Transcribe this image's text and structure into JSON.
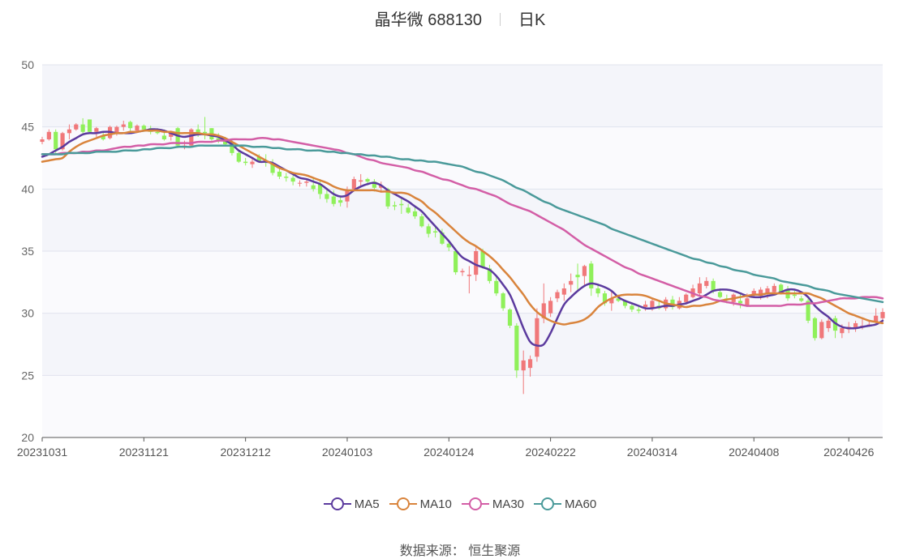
{
  "header": {
    "title": "晶华微 688130",
    "period": "日K"
  },
  "source": {
    "label": "数据来源：",
    "name": "恒生聚源"
  },
  "chart_data": {
    "type": "candlestick",
    "up_color": "#f0787a",
    "down_color": "#8ff05a",
    "ylim": [
      20,
      50
    ],
    "yticks": [
      20,
      25,
      30,
      35,
      40,
      45,
      50
    ],
    "grid": true,
    "xtick_labels": [
      "20231031",
      "20231121",
      "20231212",
      "20240103",
      "20240124",
      "20240222",
      "20240314",
      "20240408",
      "20240426"
    ],
    "xtick_index": [
      0,
      15,
      30,
      45,
      60,
      75,
      90,
      105,
      119
    ],
    "legend_position": "bottom",
    "ohlc": [
      [
        43.8,
        44.2,
        43.6,
        44.0
      ],
      [
        44.0,
        44.8,
        43.9,
        44.6
      ],
      [
        44.6,
        44.8,
        42.9,
        43.2
      ],
      [
        43.2,
        44.6,
        43.1,
        44.5
      ],
      [
        44.5,
        45.2,
        44.0,
        44.8
      ],
      [
        44.8,
        45.3,
        44.7,
        45.2
      ],
      [
        45.2,
        45.7,
        44.4,
        44.6
      ],
      [
        45.6,
        45.6,
        44.5,
        44.6
      ],
      [
        44.6,
        45.0,
        44.2,
        44.9
      ],
      [
        44.3,
        44.6,
        43.9,
        44.0
      ],
      [
        44.1,
        45.1,
        44.0,
        45.0
      ],
      [
        44.5,
        45.1,
        44.3,
        45.0
      ],
      [
        45.0,
        45.5,
        44.7,
        45.2
      ],
      [
        45.4,
        45.5,
        44.6,
        44.9
      ],
      [
        44.7,
        45.2,
        44.5,
        45.1
      ],
      [
        45.1,
        45.2,
        44.6,
        44.8
      ],
      [
        44.9,
        45.1,
        44.4,
        44.6
      ],
      [
        44.6,
        44.9,
        44.4,
        44.5
      ],
      [
        44.3,
        44.8,
        43.9,
        44.0
      ],
      [
        44.2,
        44.7,
        43.9,
        44.6
      ],
      [
        44.9,
        45.0,
        43.3,
        43.5
      ],
      [
        43.5,
        43.9,
        43.2,
        43.5
      ],
      [
        43.5,
        44.9,
        43.4,
        44.8
      ],
      [
        44.8,
        45.2,
        44.2,
        44.5
      ],
      [
        44.6,
        45.8,
        44.0,
        44.5
      ],
      [
        44.9,
        44.9,
        43.9,
        44.0
      ],
      [
        44.1,
        44.5,
        43.7,
        43.9
      ],
      [
        43.9,
        44.2,
        43.5,
        43.6
      ],
      [
        43.8,
        44.0,
        42.7,
        42.9
      ],
      [
        42.9,
        43.2,
        42.1,
        42.2
      ],
      [
        42.2,
        42.5,
        41.9,
        42.1
      ],
      [
        42.0,
        42.5,
        41.7,
        42.2
      ],
      [
        42.6,
        42.8,
        42.1,
        42.2
      ],
      [
        42.3,
        42.8,
        41.8,
        42.1
      ],
      [
        42.1,
        42.4,
        41.1,
        41.3
      ],
      [
        41.4,
        41.8,
        40.8,
        41.0
      ],
      [
        41.0,
        41.3,
        40.6,
        40.9
      ],
      [
        40.9,
        41.1,
        40.3,
        40.6
      ],
      [
        40.5,
        40.7,
        40.2,
        40.5
      ],
      [
        40.5,
        40.7,
        40.2,
        40.6
      ],
      [
        40.3,
        40.9,
        39.8,
        40.0
      ],
      [
        40.4,
        40.8,
        39.2,
        39.6
      ],
      [
        39.6,
        40.1,
        38.9,
        39.2
      ],
      [
        39.4,
        39.9,
        38.6,
        38.8
      ],
      [
        39.1,
        39.4,
        38.6,
        38.9
      ],
      [
        39.0,
        40.2,
        38.5,
        39.9
      ],
      [
        40.0,
        41.0,
        39.8,
        40.8
      ],
      [
        40.6,
        41.2,
        40.2,
        40.7
      ],
      [
        40.8,
        40.9,
        40.3,
        40.6
      ],
      [
        40.6,
        40.8,
        39.8,
        40.1
      ],
      [
        40.1,
        40.6,
        39.7,
        40.3
      ],
      [
        40.0,
        40.1,
        38.4,
        38.6
      ],
      [
        38.7,
        39.0,
        38.3,
        38.6
      ],
      [
        38.8,
        39.4,
        38.0,
        38.7
      ],
      [
        38.5,
        38.8,
        38.0,
        38.1
      ],
      [
        38.2,
        38.5,
        37.6,
        37.8
      ],
      [
        37.8,
        38.0,
        36.9,
        37.0
      ],
      [
        37.0,
        37.2,
        36.1,
        36.4
      ],
      [
        36.6,
        37.0,
        36.1,
        36.5
      ],
      [
        36.5,
        36.8,
        35.5,
        35.6
      ],
      [
        35.6,
        35.8,
        35.0,
        35.3
      ],
      [
        35.0,
        35.2,
        33.1,
        33.3
      ],
      [
        33.3,
        33.6,
        33.0,
        33.4
      ],
      [
        33.0,
        33.8,
        31.6,
        33.1
      ],
      [
        33.1,
        35.4,
        32.6,
        35.0
      ],
      [
        35.0,
        35.2,
        33.6,
        33.7
      ],
      [
        33.6,
        33.9,
        32.4,
        32.6
      ],
      [
        32.6,
        33.0,
        31.4,
        31.6
      ],
      [
        31.6,
        31.7,
        30.2,
        30.4
      ],
      [
        30.3,
        30.4,
        28.8,
        29.0
      ],
      [
        29.0,
        29.2,
        24.8,
        25.4
      ],
      [
        25.4,
        27.0,
        23.5,
        26.2
      ],
      [
        25.6,
        26.6,
        24.9,
        26.3
      ],
      [
        26.5,
        30.4,
        26.1,
        29.6
      ],
      [
        29.6,
        32.4,
        29.2,
        30.8
      ],
      [
        30.0,
        31.3,
        29.7,
        31.0
      ],
      [
        31.2,
        31.9,
        30.9,
        31.7
      ],
      [
        31.5,
        32.4,
        31.0,
        32.0
      ],
      [
        32.3,
        33.2,
        31.7,
        32.6
      ],
      [
        33.1,
        34.0,
        31.9,
        32.9
      ],
      [
        33.0,
        33.9,
        32.2,
        33.8
      ],
      [
        34.0,
        34.2,
        31.4,
        32.0
      ],
      [
        32.0,
        32.4,
        31.3,
        31.6
      ],
      [
        31.6,
        31.8,
        30.6,
        30.8
      ],
      [
        30.8,
        31.9,
        30.2,
        31.2
      ],
      [
        31.2,
        31.5,
        30.9,
        31.0
      ],
      [
        31.0,
        31.1,
        30.4,
        30.6
      ],
      [
        30.6,
        30.8,
        30.1,
        30.3
      ],
      [
        30.3,
        30.6,
        30.0,
        30.2
      ],
      [
        30.5,
        31.0,
        30.2,
        30.7
      ],
      [
        30.4,
        31.2,
        30.2,
        31.0
      ],
      [
        30.6,
        31.0,
        30.3,
        30.4
      ],
      [
        30.4,
        31.3,
        30.2,
        31.1
      ],
      [
        31.1,
        31.4,
        30.3,
        30.5
      ],
      [
        30.4,
        31.3,
        30.3,
        31.0
      ],
      [
        30.9,
        31.6,
        30.7,
        31.5
      ],
      [
        31.3,
        32.3,
        31.2,
        32.0
      ],
      [
        31.6,
        32.9,
        31.4,
        32.4
      ],
      [
        32.2,
        32.9,
        32.0,
        32.6
      ],
      [
        32.6,
        32.8,
        31.6,
        31.8
      ],
      [
        31.7,
        32.0,
        31.2,
        31.3
      ],
      [
        31.2,
        31.5,
        30.8,
        31.1
      ],
      [
        30.9,
        31.6,
        30.6,
        31.5
      ],
      [
        31.0,
        31.6,
        30.4,
        30.8
      ],
      [
        30.6,
        31.6,
        30.5,
        31.2
      ],
      [
        31.5,
        32.0,
        31.3,
        31.8
      ],
      [
        31.4,
        32.1,
        31.1,
        31.9
      ],
      [
        31.6,
        32.2,
        31.2,
        32.0
      ],
      [
        31.7,
        32.4,
        31.5,
        32.2
      ],
      [
        32.3,
        32.4,
        31.5,
        31.7
      ],
      [
        31.9,
        32.2,
        31.0,
        31.2
      ],
      [
        31.5,
        31.8,
        31.2,
        31.4
      ],
      [
        31.2,
        31.4,
        30.9,
        31.0
      ],
      [
        31.0,
        31.2,
        29.2,
        29.4
      ],
      [
        29.6,
        29.7,
        27.8,
        28.0
      ],
      [
        28.0,
        29.5,
        27.9,
        29.3
      ],
      [
        28.8,
        29.6,
        28.5,
        29.4
      ],
      [
        29.6,
        29.8,
        28.0,
        28.6
      ],
      [
        28.4,
        29.1,
        28.0,
        28.8
      ],
      [
        28.7,
        29.3,
        28.4,
        28.9
      ],
      [
        28.8,
        29.4,
        28.5,
        29.2
      ],
      [
        28.9,
        29.5,
        28.7,
        29.0
      ],
      [
        29.1,
        29.4,
        28.9,
        29.1
      ],
      [
        29.3,
        30.4,
        29.2,
        29.8
      ],
      [
        29.6,
        30.4,
        29.3,
        30.1
      ]
    ],
    "series": [
      {
        "name": "MA5",
        "color": "#5b3a9e",
        "values": [
          42.6,
          42.8,
          43.1,
          43.4,
          43.8,
          44.1,
          44.4,
          44.5,
          44.5,
          44.6,
          44.6,
          44.5,
          44.5,
          44.5,
          44.6,
          44.7,
          44.8,
          44.8,
          44.7,
          44.5,
          44.3,
          44.2,
          44.3,
          44.4,
          44.4,
          44.3,
          44.2,
          43.9,
          43.6,
          43.1,
          42.8,
          42.5,
          42.2,
          42.2,
          42.1,
          41.8,
          41.5,
          41.2,
          40.9,
          40.8,
          40.6,
          40.4,
          40.0,
          39.6,
          39.4,
          39.5,
          39.9,
          40.2,
          40.4,
          40.5,
          40.3,
          39.9,
          39.6,
          39.3,
          39.0,
          38.6,
          38.2,
          37.6,
          37.0,
          36.4,
          35.8,
          35.1,
          34.5,
          34.2,
          33.9,
          33.7,
          33.5,
          33.0,
          32.3,
          31.5,
          30.2,
          28.8,
          27.7,
          27.4,
          27.5,
          28.4,
          29.6,
          30.7,
          31.3,
          31.8,
          32.2,
          32.4,
          32.3,
          32.1,
          31.8,
          31.3,
          31.0,
          30.8,
          30.6,
          30.4,
          30.4,
          30.5,
          30.6,
          30.6,
          30.7,
          30.8,
          31.0,
          31.2,
          31.5,
          31.8,
          31.9,
          31.9,
          31.8,
          31.6,
          31.4,
          31.3,
          31.3,
          31.4,
          31.5,
          31.7,
          31.9,
          31.9,
          31.7,
          31.3,
          30.6,
          30.1,
          29.7,
          29.2,
          28.9,
          28.8,
          28.8,
          28.9,
          29.0,
          29.1,
          29.4
        ]
      },
      {
        "name": "MA10",
        "color": "#d9843c",
        "values": [
          42.2,
          42.3,
          42.4,
          42.5,
          43.0,
          43.4,
          43.7,
          43.9,
          44.1,
          44.3,
          44.4,
          44.5,
          44.5,
          44.6,
          44.6,
          44.7,
          44.7,
          44.7,
          44.6,
          44.6,
          44.5,
          44.5,
          44.5,
          44.5,
          44.4,
          44.4,
          44.3,
          44.1,
          43.8,
          43.5,
          43.2,
          42.9,
          42.6,
          42.3,
          42.0,
          41.7,
          41.5,
          41.3,
          41.2,
          41.1,
          40.9,
          40.7,
          40.5,
          40.2,
          40.0,
          39.9,
          39.9,
          39.9,
          39.9,
          39.9,
          39.8,
          39.8,
          39.7,
          39.7,
          39.6,
          39.3,
          39.0,
          38.5,
          38.1,
          37.6,
          37.1,
          36.6,
          36.1,
          35.7,
          35.4,
          35.0,
          34.6,
          34.1,
          33.5,
          32.9,
          32.2,
          31.5,
          30.7,
          30.1,
          29.7,
          29.4,
          29.2,
          29.1,
          29.2,
          29.3,
          29.5,
          29.9,
          30.5,
          30.9,
          31.2,
          31.4,
          31.5,
          31.5,
          31.5,
          31.4,
          31.2,
          31.0,
          30.8,
          30.7,
          30.6,
          30.5,
          30.6,
          30.6,
          30.7,
          30.8,
          31.0,
          31.1,
          31.2,
          31.3,
          31.4,
          31.5,
          31.5,
          31.6,
          31.6,
          31.6,
          31.6,
          31.6,
          31.6,
          31.6,
          31.4,
          31.2,
          30.9,
          30.6,
          30.3,
          30.0,
          29.8,
          29.6,
          29.4,
          29.3,
          29.2
        ]
      },
      {
        "name": "MA30",
        "color": "#d35ea6",
        "values": [
          42.8,
          42.8,
          42.8,
          42.9,
          42.9,
          42.9,
          43.0,
          43.0,
          43.1,
          43.1,
          43.2,
          43.3,
          43.4,
          43.4,
          43.5,
          43.5,
          43.6,
          43.6,
          43.6,
          43.7,
          43.7,
          43.7,
          43.7,
          43.8,
          43.8,
          43.8,
          43.9,
          43.9,
          44.0,
          44.0,
          44.0,
          44.0,
          44.1,
          44.1,
          44.0,
          44.0,
          43.9,
          43.8,
          43.7,
          43.6,
          43.5,
          43.4,
          43.3,
          43.2,
          43.1,
          42.9,
          42.8,
          42.6,
          42.4,
          42.3,
          42.1,
          42.0,
          41.9,
          41.8,
          41.7,
          41.5,
          41.4,
          41.2,
          41.0,
          40.8,
          40.7,
          40.5,
          40.3,
          40.1,
          40.0,
          39.8,
          39.6,
          39.4,
          39.1,
          38.8,
          38.6,
          38.4,
          38.2,
          37.9,
          37.6,
          37.3,
          37.0,
          36.7,
          36.3,
          35.9,
          35.5,
          35.2,
          34.9,
          34.6,
          34.3,
          34.0,
          33.7,
          33.5,
          33.2,
          33.0,
          32.8,
          32.6,
          32.4,
          32.2,
          32.0,
          31.8,
          31.6,
          31.4,
          31.3,
          31.1,
          31.0,
          30.9,
          30.8,
          30.7,
          30.6,
          30.6,
          30.6,
          30.6,
          30.6,
          30.6,
          30.7,
          30.7,
          30.7,
          30.8,
          30.8,
          30.9,
          31.0,
          31.1,
          31.2,
          31.2,
          31.2,
          31.3,
          31.3,
          31.3,
          31.2
        ]
      },
      {
        "name": "MA60",
        "color": "#4a9a9a",
        "values": [
          42.8,
          42.8,
          42.8,
          42.8,
          42.9,
          42.9,
          42.9,
          42.9,
          43.0,
          43.0,
          43.0,
          43.0,
          43.1,
          43.1,
          43.1,
          43.2,
          43.2,
          43.3,
          43.3,
          43.3,
          43.4,
          43.4,
          43.4,
          43.5,
          43.5,
          43.5,
          43.5,
          43.5,
          43.5,
          43.5,
          43.5,
          43.4,
          43.4,
          43.4,
          43.3,
          43.3,
          43.2,
          43.2,
          43.2,
          43.1,
          43.1,
          43.1,
          43.0,
          43.0,
          42.9,
          42.9,
          42.8,
          42.8,
          42.7,
          42.7,
          42.6,
          42.6,
          42.5,
          42.4,
          42.4,
          42.3,
          42.3,
          42.2,
          42.2,
          42.1,
          42.0,
          41.9,
          41.8,
          41.6,
          41.4,
          41.3,
          41.1,
          40.9,
          40.7,
          40.4,
          40.1,
          39.9,
          39.6,
          39.3,
          39.0,
          38.8,
          38.5,
          38.3,
          38.1,
          37.9,
          37.7,
          37.5,
          37.3,
          37.1,
          36.8,
          36.6,
          36.4,
          36.2,
          36.0,
          35.8,
          35.6,
          35.4,
          35.2,
          35.0,
          34.8,
          34.6,
          34.4,
          34.3,
          34.1,
          34.0,
          33.8,
          33.7,
          33.5,
          33.4,
          33.3,
          33.1,
          33.0,
          32.9,
          32.8,
          32.6,
          32.5,
          32.4,
          32.3,
          32.2,
          32.0,
          31.9,
          31.8,
          31.6,
          31.5,
          31.4,
          31.3,
          31.2,
          31.1,
          31.0,
          30.9
        ]
      }
    ]
  }
}
